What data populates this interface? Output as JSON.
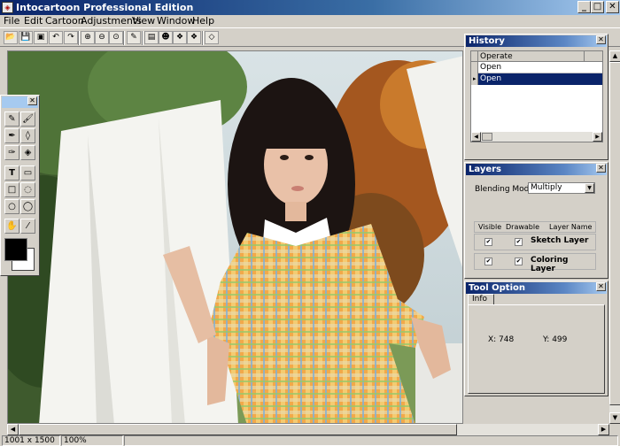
{
  "app": {
    "title": "Intocartoon Professional Edition"
  },
  "menu": [
    "File",
    "Edit",
    "Cartoon",
    "Adjustments",
    "View",
    "Window",
    "Help"
  ],
  "toolbar_icons": [
    "open-icon",
    "save-icon",
    "save-as-icon",
    "undo-icon",
    "redo-icon",
    "zoom-in-icon",
    "zoom-out-icon",
    "zoom-fit-icon",
    "adjust-icon",
    "sketch-icon",
    "cartoon-icon",
    "filter-a-icon",
    "filter-b-icon",
    "eraser-icon"
  ],
  "toolbox": {
    "icons": [
      "pencil-icon",
      "brush-icon",
      "sketch-pen-icon",
      "eraser-icon",
      "color-brush-icon",
      "color-eraser-icon",
      "text-icon",
      "callout-icon",
      "rectangle-icon",
      "speech-balloon-icon",
      "ellipse-icon",
      "round-balloon-icon",
      "hand-icon",
      "eyedropper-icon"
    ],
    "foreground_color": "#000000",
    "background_color": "#ffffff"
  },
  "history": {
    "title": "History",
    "column": "Operate",
    "rows": [
      "Open",
      "Open"
    ],
    "selected_index": 1
  },
  "layers": {
    "title": "Layers",
    "blending_label": "Blending Mode:",
    "blending_value": "Multiply",
    "col_visible": "Visible",
    "col_drawable": "Drawable",
    "col_name": "Layer Name",
    "rows": [
      {
        "name": "Sketch Layer",
        "visible": true,
        "drawable": true
      },
      {
        "name": "Coloring Layer",
        "visible": true,
        "drawable": true
      }
    ]
  },
  "tool_option": {
    "title": "Tool Option",
    "tab": "Info",
    "x_label": "X: 748",
    "y_label": "Y: 499"
  },
  "status": {
    "size": "1001 x 1500",
    "zoom": "100%"
  },
  "colors": {
    "title_blue": "#0a246a",
    "selection": "#0a246a",
    "panel_bg": "#d4d0c8"
  }
}
